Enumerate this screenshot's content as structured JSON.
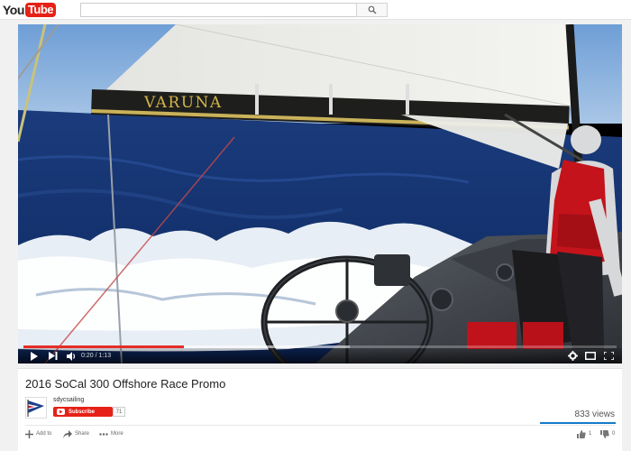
{
  "masthead": {
    "logo_you": "You",
    "logo_tube": "Tube",
    "search_placeholder": ""
  },
  "player": {
    "overlay_text": "VARUNA",
    "current_time": "0:20",
    "duration": "1:13",
    "time_separator": " / ",
    "played_fraction": 0.27,
    "buffered_fraction": 0.55
  },
  "video": {
    "title": "2016 SoCal 300 Offshore Race Promo",
    "channel_name": "sdycsailing",
    "subscribe_label": "Subscribe",
    "subscriber_count": "71",
    "views": "833 views",
    "like_fraction": 1.0
  },
  "actions": {
    "add_to": "Add to",
    "share": "Share",
    "more": "More",
    "likes": "1",
    "dislikes": "0"
  },
  "colors": {
    "brand_red": "#e62117",
    "progress_red": "#e52d27",
    "like_blue": "#167ac6"
  },
  "icons": [
    "search-icon",
    "play-icon",
    "next-icon",
    "volume-icon",
    "settings-icon",
    "miniplayer-icon",
    "fullscreen-icon",
    "add-icon",
    "share-icon",
    "more-icon",
    "like-icon",
    "dislike-icon",
    "channel-burgee-icon"
  ]
}
